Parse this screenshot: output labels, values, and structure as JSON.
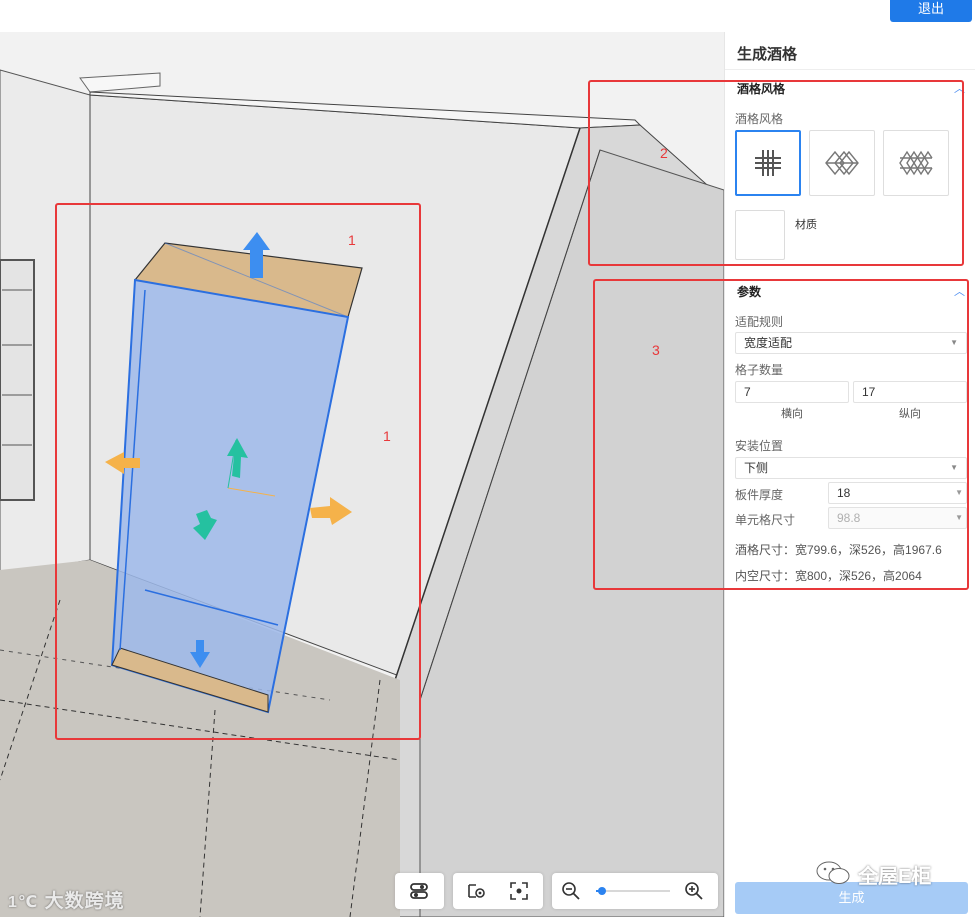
{
  "header": {
    "exit_label": "退出"
  },
  "panel": {
    "title": "生成酒格",
    "style_section": {
      "heading": "酒格风格",
      "label": "酒格风格",
      "options": [
        "grid-pattern-icon",
        "diamond-lattice-icon",
        "diamond-lattice-dense-icon"
      ],
      "selected_index": 0,
      "material_label": "材质"
    },
    "params_section": {
      "heading": "参数",
      "fit_rule_label": "适配规则",
      "fit_rule_value": "宽度适配",
      "grid_count_label": "格子数量",
      "horizontal_value": "7",
      "horizontal_label": "横向",
      "vertical_value": "17",
      "vertical_label": "纵向",
      "install_position_label": "安装位置",
      "install_position_value": "下侧",
      "panel_thickness_label": "板件厚度",
      "panel_thickness_value": "18",
      "cell_size_label": "单元格尺寸",
      "cell_size_value": "98.8",
      "rack_size_text": "酒格尺寸：宽799.6，深526，高1967.6",
      "inner_size_text": "内空尺寸：宽800，深526，高2064"
    },
    "generate_label": "生成"
  },
  "annotations": {
    "label_1a": "1",
    "label_1b": "1",
    "label_2": "2",
    "label_3": "3"
  },
  "colors": {
    "accent": "#1f7ae8",
    "selection_blue": "#2b83f0",
    "annotation_red": "#e8383a"
  },
  "watermarks": {
    "left": "大数跨境",
    "right": "全屋E柜"
  },
  "toolbar": {
    "icons": [
      "layer-toggle-icon",
      "view-settings-icon",
      "focus-icon",
      "zoom-out-icon",
      "zoom-slider",
      "zoom-in-icon"
    ],
    "zoom_level": 0.05
  }
}
